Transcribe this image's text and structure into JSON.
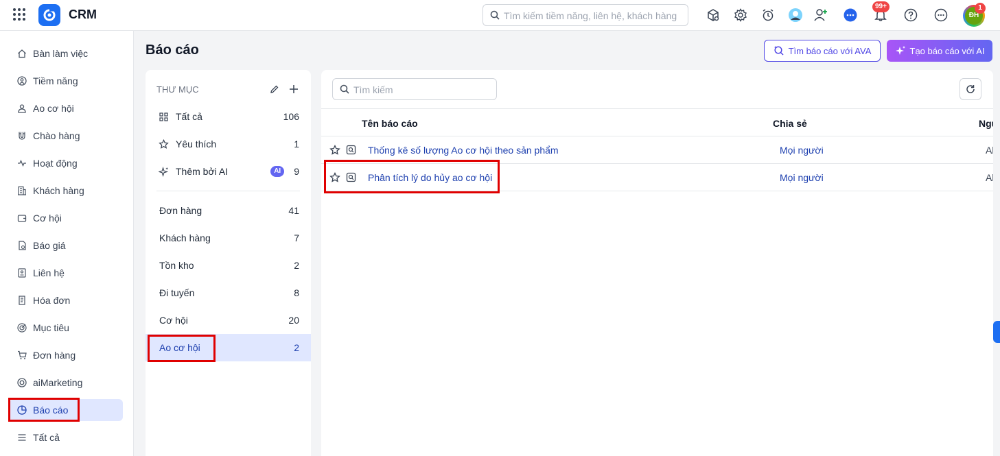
{
  "app": {
    "title": "CRM"
  },
  "top_search": {
    "placeholder": "Tìm kiếm tiềm năng, liên hệ, khách hàng"
  },
  "top_icons": [
    "package-search-icon",
    "gear-icon",
    "alarm-clock-icon",
    "user-avatar-icon",
    "add-user-icon",
    "chat-icon",
    "bell-icon",
    "help-icon",
    "more-icon"
  ],
  "notifications": {
    "badge": "99+"
  },
  "user": {
    "initials": "ĐH",
    "badge": "1"
  },
  "sidebar": {
    "items": [
      {
        "label": "Bàn làm việc",
        "icon": "home-icon"
      },
      {
        "label": "Tiềm năng",
        "icon": "target-user-icon"
      },
      {
        "label": "Ao cơ hội",
        "icon": "users-icon"
      },
      {
        "label": "Chào hàng",
        "icon": "magnet-icon"
      },
      {
        "label": "Hoạt động",
        "icon": "activity-icon"
      },
      {
        "label": "Khách hàng",
        "icon": "building-icon"
      },
      {
        "label": "Cơ hội",
        "icon": "wallet-icon"
      },
      {
        "label": "Báo giá",
        "icon": "file-dollar-icon"
      },
      {
        "label": "Liên hệ",
        "icon": "contact-card-icon"
      },
      {
        "label": "Hóa đơn",
        "icon": "receipt-icon"
      },
      {
        "label": "Mục tiêu",
        "icon": "goal-icon"
      },
      {
        "label": "Đơn hàng",
        "icon": "cart-icon"
      },
      {
        "label": "aiMarketing",
        "icon": "ai-marketing-icon"
      },
      {
        "label": "Báo cáo",
        "icon": "pie-chart-icon",
        "active": true
      },
      {
        "label": "Tất cả",
        "icon": "menu-icon"
      }
    ]
  },
  "page": {
    "title": "Báo cáo"
  },
  "actions": {
    "ava_label": "Tìm báo cáo với AVA",
    "ai_label": "Tạo báo cáo với AI"
  },
  "folders": {
    "title": "THƯ MỤC",
    "quick": [
      {
        "label": "Tất cả",
        "count": "106"
      },
      {
        "label": "Yêu thích",
        "count": "1"
      },
      {
        "label": "Thêm bởi AI",
        "count": "9",
        "chip": "AI"
      }
    ],
    "list": [
      {
        "label": "Đơn hàng",
        "count": "41"
      },
      {
        "label": "Khách hàng",
        "count": "7"
      },
      {
        "label": "Tồn kho",
        "count": "2"
      },
      {
        "label": "Đi tuyến",
        "count": "8"
      },
      {
        "label": "Cơ hội",
        "count": "20"
      },
      {
        "label": "Ao cơ hội",
        "count": "2",
        "active": true
      }
    ]
  },
  "reports": {
    "search_placeholder": "Tìm kiếm",
    "columns": {
      "name": "Tên báo cáo",
      "share": "Chia sẻ",
      "owner": "Ngư"
    },
    "rows": [
      {
        "name": "Thống kê số lượng Ao cơ hội theo sản phẩm",
        "share": "Mọi người",
        "owner": "Al"
      },
      {
        "name": "Phân tích lý do hủy ao cơ hội",
        "share": "Mọi người",
        "owner": "Al"
      }
    ]
  },
  "colors": {
    "accent": "#1d6ff2",
    "link": "#1e40af",
    "highlight": "#e00000",
    "active_bg": "#e0e7ff"
  }
}
